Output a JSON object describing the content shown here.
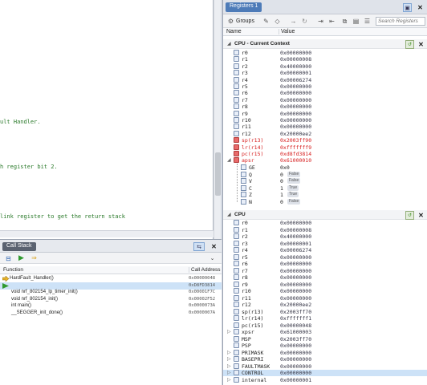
{
  "editor": {
    "lines": [
      {
        "text": "ult Handler.",
        "row": 0
      },
      {
        "text": "h register bit 2.",
        "row": 1
      },
      {
        "text": "link register to get the return stack",
        "row": 2
      }
    ]
  },
  "call_stack": {
    "tab_label": "Call Stack",
    "col_function": "Function",
    "col_address": "Call Address",
    "rows": [
      {
        "function": "HardFault_Handler()",
        "address": "0x00000048",
        "indent": 0,
        "selected": false,
        "marker": "arrow"
      },
      {
        "function": "",
        "address": "0xD8FD3814",
        "indent": 0,
        "selected": true,
        "marker": "play"
      },
      {
        "function": "void nrf_802154_lp_timer_init()",
        "address": "0x00001F7C",
        "indent": 1,
        "selected": false,
        "marker": ""
      },
      {
        "function": "void nrf_802154_init()",
        "address": "0x00002F52",
        "indent": 1,
        "selected": false,
        "marker": ""
      },
      {
        "function": "int main()",
        "address": "0x0000073A",
        "indent": 1,
        "selected": false,
        "marker": ""
      },
      {
        "function": "__SEGGER_init_done()",
        "address": "0x0000007A",
        "indent": 1,
        "selected": false,
        "marker": ""
      }
    ]
  },
  "registers": {
    "tab_label": "Registers 1",
    "groups_label": "Groups",
    "search_placeholder": "Search Registers",
    "col_name": "Name",
    "col_value": "Value",
    "section1_label": "CPU - Current Context",
    "section1_rows": [
      {
        "name": "r0",
        "value": "0x00000000",
        "changed": false
      },
      {
        "name": "r1",
        "value": "0x00000008",
        "changed": false
      },
      {
        "name": "r2",
        "value": "0x40000000",
        "changed": false
      },
      {
        "name": "r3",
        "value": "0x00000001",
        "changed": false
      },
      {
        "name": "r4",
        "value": "0x00006274",
        "changed": false
      },
      {
        "name": "r5",
        "value": "0x00000000",
        "changed": false
      },
      {
        "name": "r6",
        "value": "0x00000000",
        "changed": false
      },
      {
        "name": "r7",
        "value": "0x00000000",
        "changed": false
      },
      {
        "name": "r8",
        "value": "0x00000000",
        "changed": false
      },
      {
        "name": "r9",
        "value": "0x00000000",
        "changed": false
      },
      {
        "name": "r10",
        "value": "0x00000000",
        "changed": false
      },
      {
        "name": "r11",
        "value": "0x00000000",
        "changed": false
      },
      {
        "name": "r12",
        "value": "0x20000ee2",
        "changed": false
      },
      {
        "name": "sp(r13)",
        "value": "0x2003ff90",
        "changed": true
      },
      {
        "name": "lr(r14)",
        "value": "0xfffffff9",
        "changed": true
      },
      {
        "name": "pc(r15)",
        "value": "0xd8fd3814",
        "changed": true
      },
      {
        "name": "apsr",
        "value": "0x61000010",
        "changed": true
      }
    ],
    "apsr_flags": [
      {
        "name": "GE",
        "value": "0x0",
        "badge": ""
      },
      {
        "name": "Q",
        "value": "0",
        "badge": "False"
      },
      {
        "name": "V",
        "value": "0",
        "badge": "False"
      },
      {
        "name": "C",
        "value": "1",
        "badge": "True"
      },
      {
        "name": "Z",
        "value": "1",
        "badge": "True"
      },
      {
        "name": "N",
        "value": "0",
        "badge": "False"
      }
    ],
    "section2_label": "CPU",
    "section2_rows": [
      {
        "name": "r0",
        "value": "0x00000000",
        "expandable": false
      },
      {
        "name": "r1",
        "value": "0x00000008",
        "expandable": false
      },
      {
        "name": "r2",
        "value": "0x40000000",
        "expandable": false
      },
      {
        "name": "r3",
        "value": "0x00000001",
        "expandable": false
      },
      {
        "name": "r4",
        "value": "0x00006274",
        "expandable": false
      },
      {
        "name": "r5",
        "value": "0x00000000",
        "expandable": false
      },
      {
        "name": "r6",
        "value": "0x00000000",
        "expandable": false
      },
      {
        "name": "r7",
        "value": "0x00000000",
        "expandable": false
      },
      {
        "name": "r8",
        "value": "0x00000000",
        "expandable": false
      },
      {
        "name": "r9",
        "value": "0x00000000",
        "expandable": false
      },
      {
        "name": "r10",
        "value": "0x00000000",
        "expandable": false
      },
      {
        "name": "r11",
        "value": "0x00000000",
        "expandable": false
      },
      {
        "name": "r12",
        "value": "0x20000ee2",
        "expandable": false
      },
      {
        "name": "sp(r13)",
        "value": "0x2003ff70",
        "expandable": false
      },
      {
        "name": "lr(r14)",
        "value": "0xfffffff1",
        "expandable": false
      },
      {
        "name": "pc(r15)",
        "value": "0x00000048",
        "expandable": false
      },
      {
        "name": "xpsr",
        "value": "0x61000003",
        "expandable": true
      },
      {
        "name": "MSP",
        "value": "0x2003ff70",
        "expandable": false
      },
      {
        "name": "PSP",
        "value": "0x00000000",
        "expandable": false
      },
      {
        "name": "PRIMASK",
        "value": "0x00000000",
        "expandable": true
      },
      {
        "name": "BASEPRI",
        "value": "0x00000000",
        "expandable": true
      },
      {
        "name": "FAULTMASK",
        "value": "0x00000000",
        "expandable": true
      },
      {
        "name": "CONTROL",
        "value": "0x00000000",
        "expandable": true
      },
      {
        "name": "internal",
        "value": "0x00000001",
        "expandable": true
      }
    ]
  }
}
